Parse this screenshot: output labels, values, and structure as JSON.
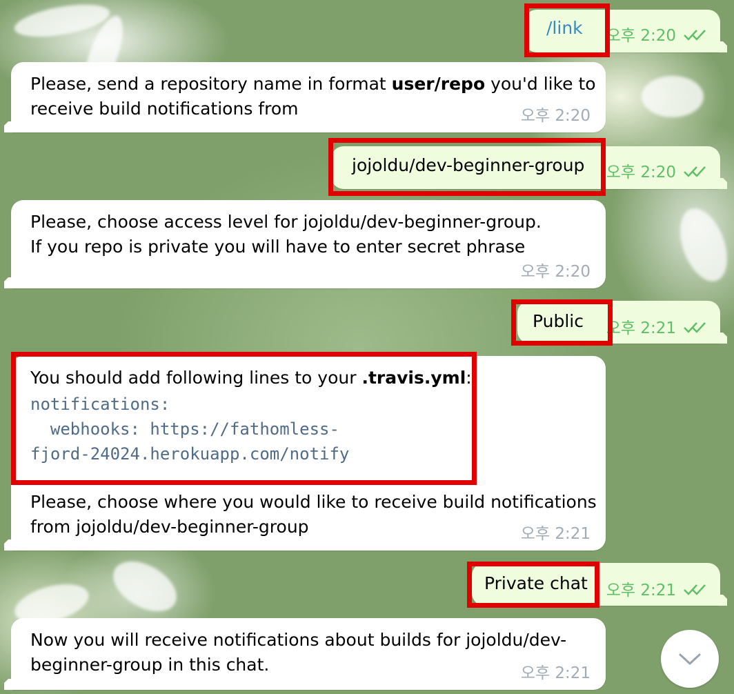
{
  "time_prefix": "오후",
  "messages": [
    {
      "dir": "out",
      "text": "/link",
      "time": "오후 2:20",
      "link": true
    },
    {
      "dir": "in",
      "pre": "Please, send a repository name in format ",
      "bold": "user/repo",
      "post": " you'd like to",
      "line2": "receive build notifications from",
      "time": "오후 2:20"
    },
    {
      "dir": "out",
      "text": "jojoldu/dev-beginner-group",
      "time": "오후 2:20"
    },
    {
      "dir": "in",
      "line1": "Please, choose access level for jojoldu/dev-beginner-group.",
      "line2": "If you repo is private you will have to enter secret phrase",
      "time": "오후 2:20"
    },
    {
      "dir": "out",
      "text": "Public",
      "time": "오후 2:21"
    },
    {
      "dir": "in",
      "pre": "You should add following lines to your ",
      "bold": ".travis.yml",
      "post": ":",
      "code1": "notifications:",
      "code2": "  webhooks: https://fathomless-",
      "code3": "fjord-24024.herokuapp.com/notify",
      "line4": "Please, choose where you would like to receive build notifications",
      "line5": "from jojoldu/dev-beginner-group",
      "time": "오후 2:21"
    },
    {
      "dir": "out",
      "text": "Private chat",
      "time": "오후 2:21"
    },
    {
      "dir": "in",
      "line1": "Now you will receive notifications about builds for jojoldu/dev-",
      "line2": "beginner-group in this chat.",
      "time": "오후 2:21"
    }
  ],
  "colors": {
    "highlight": "#e00000",
    "link": "#3a88c4",
    "outgoing_bg": "#effdde",
    "time_out": "#5fbe67",
    "time_in": "#a0acb6"
  },
  "icons": {
    "read_ticks": "double-check-icon",
    "scroll": "chevron-down-icon"
  }
}
